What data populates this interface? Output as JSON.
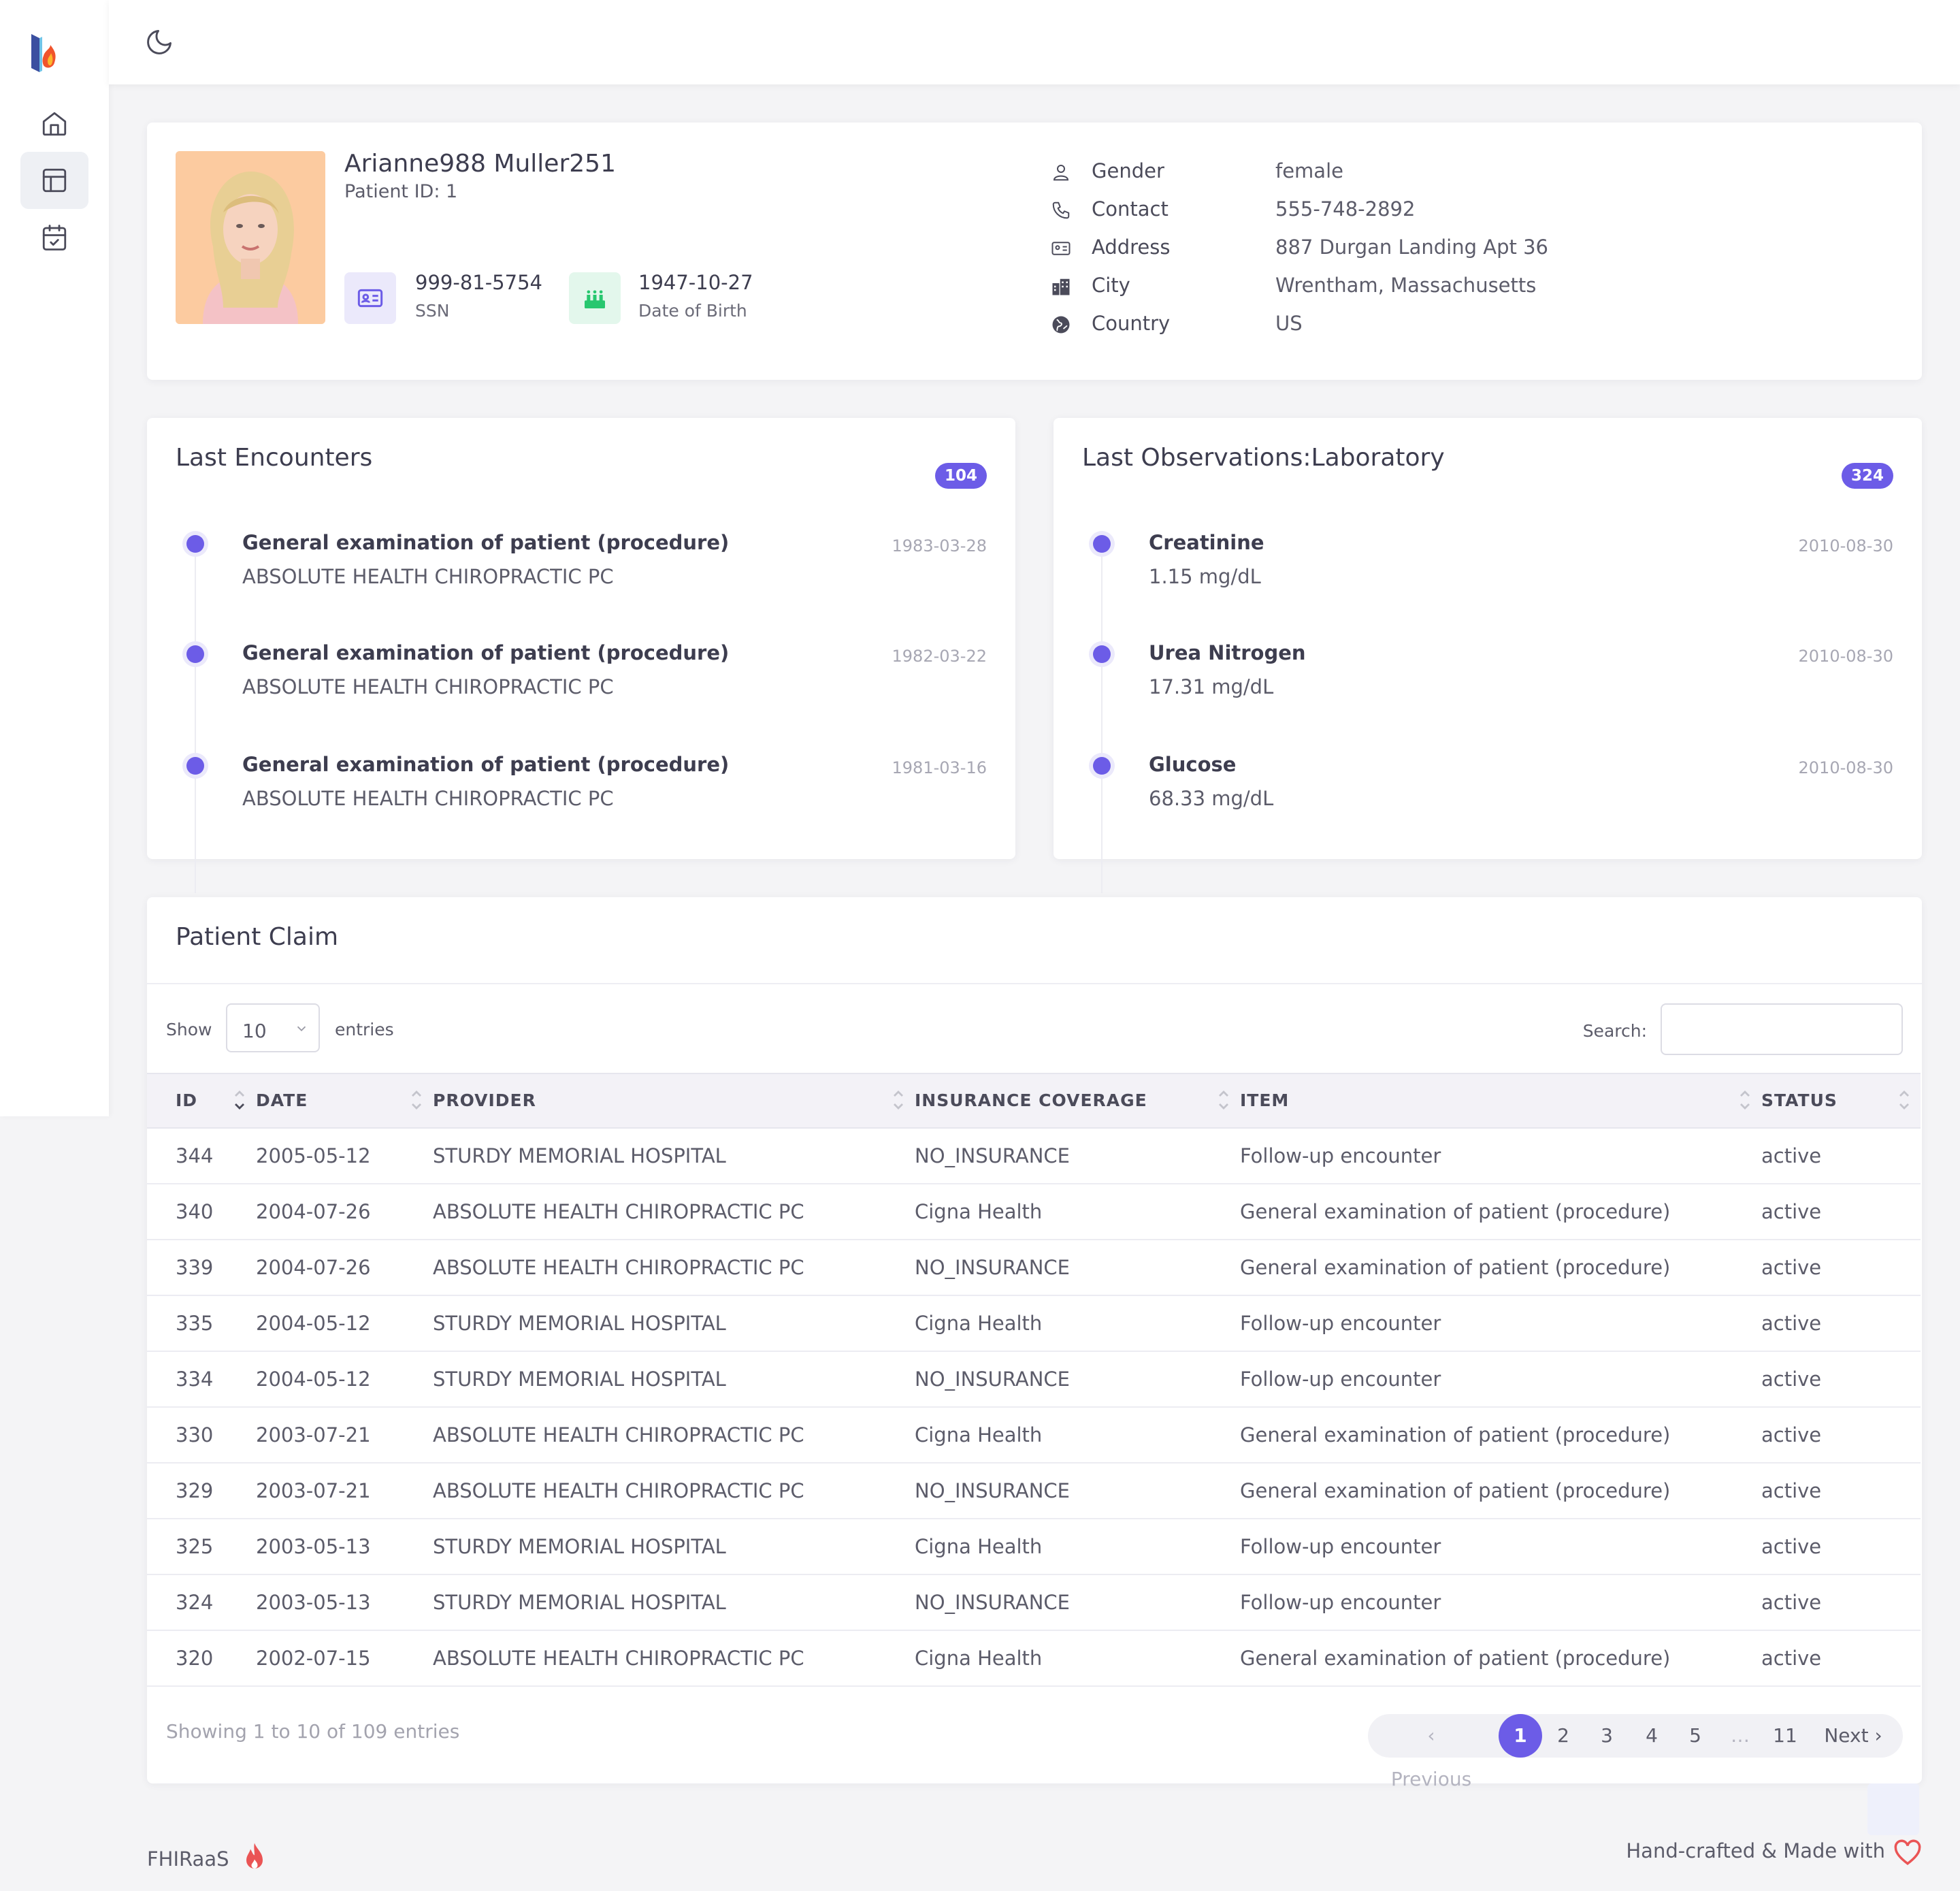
{
  "sidebar": {
    "items": [
      {
        "name": "home",
        "icon": "home-icon"
      },
      {
        "name": "layout",
        "icon": "layout-icon",
        "active": true
      },
      {
        "name": "calendar",
        "icon": "calendar-check-icon"
      }
    ]
  },
  "topbar": {
    "theme_toggle_icon": "moon-icon"
  },
  "patient": {
    "name": "Arianne988 Muller251",
    "id_label": "Patient ID: 1",
    "ssn": "999-81-5754",
    "ssn_label": "SSN",
    "dob": "1947-10-27",
    "dob_label": "Date of Birth",
    "details": [
      {
        "label": "Gender",
        "value": "female",
        "icon": "user-icon"
      },
      {
        "label": "Contact",
        "value": "555-748-2892",
        "icon": "phone-icon"
      },
      {
        "label": "Address",
        "value": "887 Durgan Landing Apt 36",
        "icon": "id-card-icon"
      },
      {
        "label": "City",
        "value": "Wrentham, Massachusetts",
        "icon": "city-icon"
      },
      {
        "label": "Country",
        "value": "US",
        "icon": "globe-icon"
      }
    ]
  },
  "encounters": {
    "title": "Last Encounters",
    "count": "104",
    "items": [
      {
        "title": "General examination of patient (procedure)",
        "sub": "ABSOLUTE HEALTH CHIROPRACTIC PC",
        "date": "1983-03-28"
      },
      {
        "title": "General examination of patient (procedure)",
        "sub": "ABSOLUTE HEALTH CHIROPRACTIC PC",
        "date": "1982-03-22"
      },
      {
        "title": "General examination of patient (procedure)",
        "sub": "ABSOLUTE HEALTH CHIROPRACTIC PC",
        "date": "1981-03-16"
      }
    ]
  },
  "observations": {
    "title": "Last Observations:Laboratory",
    "count": "324",
    "items": [
      {
        "title": "Creatinine",
        "sub": "1.15 mg/dL",
        "date": "2010-08-30"
      },
      {
        "title": "Urea Nitrogen",
        "sub": "17.31 mg/dL",
        "date": "2010-08-30"
      },
      {
        "title": "Glucose",
        "sub": "68.33 mg/dL",
        "date": "2010-08-30"
      }
    ]
  },
  "claims": {
    "title": "Patient Claim",
    "show_label": "Show",
    "page_size": "10",
    "entries_label": "entries",
    "search_label": "Search:",
    "search_value": "",
    "columns": [
      "ID",
      "DATE",
      "PROVIDER",
      "INSURANCE COVERAGE",
      "ITEM",
      "STATUS"
    ],
    "rows": [
      [
        "344",
        "2005-05-12",
        "STURDY MEMORIAL HOSPITAL",
        "NO_INSURANCE",
        "Follow-up encounter",
        "active"
      ],
      [
        "340",
        "2004-07-26",
        "ABSOLUTE HEALTH CHIROPRACTIC PC",
        "Cigna Health",
        "General examination of patient (procedure)",
        "active"
      ],
      [
        "339",
        "2004-07-26",
        "ABSOLUTE HEALTH CHIROPRACTIC PC",
        "NO_INSURANCE",
        "General examination of patient (procedure)",
        "active"
      ],
      [
        "335",
        "2004-05-12",
        "STURDY MEMORIAL HOSPITAL",
        "Cigna Health",
        "Follow-up encounter",
        "active"
      ],
      [
        "334",
        "2004-05-12",
        "STURDY MEMORIAL HOSPITAL",
        "NO_INSURANCE",
        "Follow-up encounter",
        "active"
      ],
      [
        "330",
        "2003-07-21",
        "ABSOLUTE HEALTH CHIROPRACTIC PC",
        "Cigna Health",
        "General examination of patient (procedure)",
        "active"
      ],
      [
        "329",
        "2003-07-21",
        "ABSOLUTE HEALTH CHIROPRACTIC PC",
        "NO_INSURANCE",
        "General examination of patient (procedure)",
        "active"
      ],
      [
        "325",
        "2003-05-13",
        "STURDY MEMORIAL HOSPITAL",
        "Cigna Health",
        "Follow-up encounter",
        "active"
      ],
      [
        "324",
        "2003-05-13",
        "STURDY MEMORIAL HOSPITAL",
        "NO_INSURANCE",
        "Follow-up encounter",
        "active"
      ],
      [
        "320",
        "2002-07-15",
        "ABSOLUTE HEALTH CHIROPRACTIC PC",
        "Cigna Health",
        "General examination of patient (procedure)",
        "active"
      ]
    ],
    "showing": "Showing 1 to 10 of 109 entries",
    "pagination": {
      "previous": "Previous",
      "pages": [
        "1",
        "2",
        "3",
        "4",
        "5",
        "…",
        "11"
      ],
      "current": "1",
      "next": "Next"
    }
  },
  "footer": {
    "brand": "FHIRaaS",
    "credit": "Hand-crafted & Made with"
  },
  "colors": {
    "accent": "#6c5ce7",
    "chip_ssn_bg": "#ebe9fb",
    "chip_dob_bg": "#e3f7ec",
    "dob_icon": "#28c76f"
  }
}
